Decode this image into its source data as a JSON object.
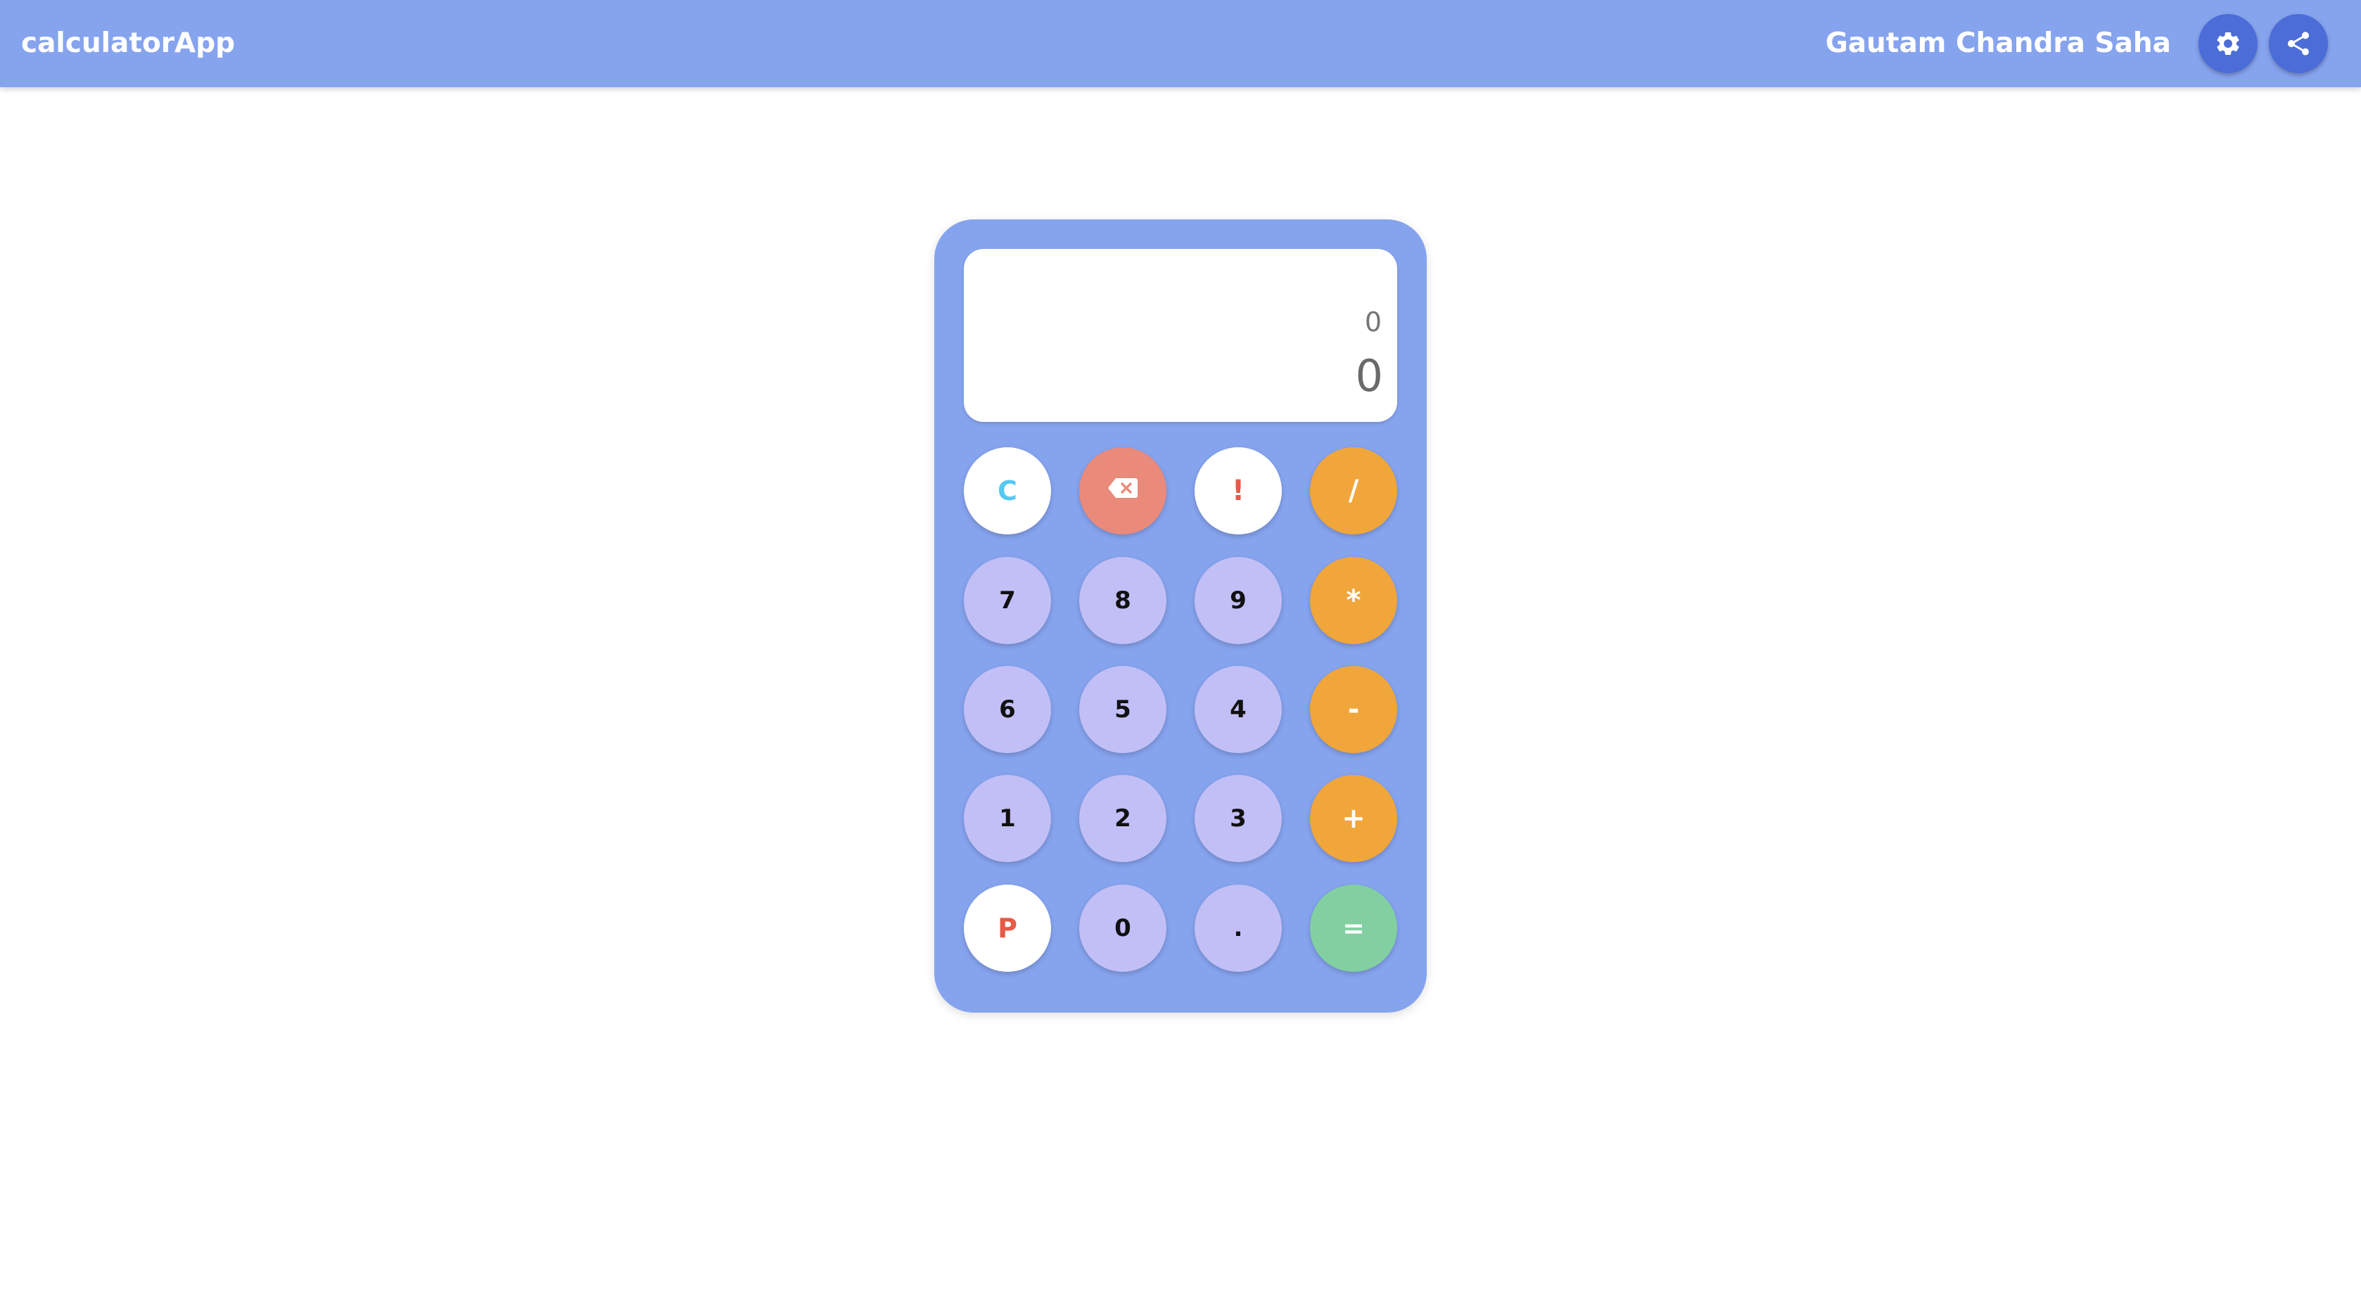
{
  "app": {
    "title": "calculatorApp",
    "user_name": "Gautam Chandra Saha"
  },
  "toolbar": {
    "settings_icon": "gear-icon",
    "share_icon": "share-icon"
  },
  "colors": {
    "primary": "#86a3ee",
    "icon_button": "#4c6dd8",
    "number_key": "#c2bff7",
    "operator_key": "#f0a63a",
    "equals_key": "#82d0a1",
    "backspace_key": "#e98a7b"
  },
  "display": {
    "expression": "0",
    "result": "0"
  },
  "keys": {
    "clear": "C",
    "backspace_icon": "backspace-icon",
    "factorial": "!",
    "divide": "/",
    "seven": "7",
    "eight": "8",
    "nine": "9",
    "multiply": "*",
    "six": "6",
    "five": "5",
    "four": "4",
    "subtract": "-",
    "one": "1",
    "two": "2",
    "three": "3",
    "add": "+",
    "percent": "P",
    "zero": "0",
    "decimal": ".",
    "equals": "="
  }
}
